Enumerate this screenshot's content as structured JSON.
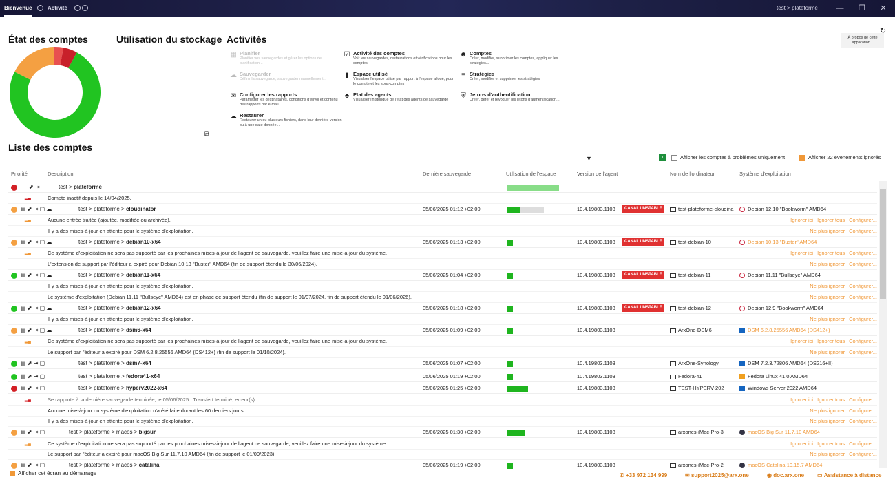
{
  "topbar": {
    "tabs": [
      {
        "label": "Bienvenue"
      },
      {
        "label": "Activité"
      }
    ],
    "path": "test > plateforme"
  },
  "sections": {
    "accounts_state": "État des comptes",
    "storage": "Utilisation du stockage",
    "activities": "Activités",
    "accounts_list": "Liste des comptes"
  },
  "about": {
    "label": "À propos de cette application..."
  },
  "activities": [
    {
      "title": "Planifier",
      "desc": "Planifier vos sauvegardes et gérer les options de planification...",
      "icon": "calendar-icon"
    },
    {
      "title": "Sauvegarder",
      "desc": "Définir la sauvegarde, sauvegarder manuellement...",
      "icon": "cloud-upload-icon"
    },
    {
      "title": "Configurer les rapports",
      "desc": "Paramétrer les destinataires, conditions d'envoi et contenu des rapports par e-mail...",
      "icon": "mail-icon"
    },
    {
      "title": "Restaurer",
      "desc": "Restaurer un ou plusieurs fichiers, dans leur dernière version ou à une date donnée...",
      "icon": "cloud-download-icon"
    },
    {
      "title": "Activité des comptes",
      "desc": "Voir les sauvegardes, restaurations et vérifications pour les comptes",
      "icon": "checklist-icon"
    },
    {
      "title": "Espace utilisé",
      "desc": "Visualiser l'espace utilisé par rapport à l'espace alloué, pour le compte et les sous-comptes",
      "icon": "bar-chart-icon"
    },
    {
      "title": "État des agents",
      "desc": "Visualiser l'historique de l'état des agents de sauvegarde",
      "icon": "agents-icon"
    },
    {
      "title": "Comptes",
      "desc": "Créer, modifier, supprimer les comptes, appliquer les stratégies...",
      "icon": "users-icon"
    },
    {
      "title": "Stratégies",
      "desc": "Créer, modifier et supprimer les stratégies",
      "icon": "strategy-icon"
    },
    {
      "title": "Jetons d'authentification",
      "desc": "Créer, gérer et révoquer les jetons d'authentification...",
      "icon": "shield-icon"
    }
  ],
  "donut": {
    "segments": [
      {
        "label": "ok",
        "fraction": 0.745,
        "color": "#21c421"
      },
      {
        "label": "warning",
        "fraction": 0.17,
        "color": "#f4a042"
      },
      {
        "label": "warning-alt",
        "fraction": 0.035,
        "color": "#e85050"
      },
      {
        "label": "error",
        "fraction": 0.05,
        "color": "#c8202a"
      }
    ]
  },
  "filters": {
    "problems_only": "Afficher les comptes à problèmes uniquement",
    "show_ignored": "Afficher 22 évènements ignorés"
  },
  "columns": [
    "Priorité",
    "Description",
    "Dernière sauvegarde",
    "Utilisation de l'espace",
    "Version de l'agent",
    "Nom de l'ordinateur",
    "Système d'exploitation"
  ],
  "accounts": {
    "root": {
      "name": "plateforme",
      "prefix": "test > ",
      "usage": 1.0,
      "status": "#d32026"
    },
    "root_msg": "Compte inactif depuis le 14/04/2025.",
    "cloudinator": {
      "path": "test > plateforme > ",
      "name": "cloudinator",
      "date": "05/06/2025 01:12 +02:00",
      "usage": 0.38,
      "version": "10.4.19803.1103",
      "badge": "CANAL UNSTABLE",
      "computer": "test-plateforme-cloudina",
      "os": "Debian 12.10 \"Bookworm\" AMD64"
    },
    "cloudinator_msg1": "Aucune entrée traitée (ajoutée, modifiée ou archivée).",
    "cloudinator_msg2": "Il y a des mises-à-jour en attente pour le système d'exploitation.",
    "debian10": {
      "path": "test > plateforme > ",
      "name": "debian10-x64",
      "date": "05/06/2025 01:13 +02:00",
      "usage": 0.12,
      "version": "10.4.19803.1103",
      "badge": "CANAL UNSTABLE",
      "computer": "test-debian-10",
      "os": "Debian 10.13 \"Buster\" AMD64"
    },
    "debian10_msg1": "Ce système d'exploitation ne sera pas supporté par les prochaines mises-à-jour de l'agent de sauvegarde, veuillez faire une mise-à-jour du système.",
    "debian10_msg2": "L'extension de support par l'éditeur a expiré pour Debian 10.13 \"Buster\" AMD64 (fin de support étendu le 30/06/2024).",
    "debian11": {
      "path": "test > plateforme > ",
      "name": "debian11-x64",
      "date": "05/06/2025 01:04 +02:00",
      "usage": 0.12,
      "version": "10.4.19803.1103",
      "badge": "CANAL UNSTABLE",
      "computer": "test-debian-11",
      "os": "Debian 11.11 \"Bullseye\" AMD64"
    },
    "debian11_msg1": "Il y a des mises-à-jour en attente pour le système d'exploitation.",
    "debian11_msg2": "Le système d'exploitation (Debian 11.11 \"Bullseye\" AMD64) est en phase de support étendu (fin de support le 01/07/2024, fin de support étendu le 01/06/2026).",
    "debian12": {
      "path": "test > plateforme > ",
      "name": "debian12-x64",
      "date": "05/06/2025 01:18 +02:00",
      "usage": 0.12,
      "version": "10.4.19803.1103",
      "badge": "CANAL UNSTABLE",
      "computer": "test-debian-12",
      "os": "Debian 12.9 \"Bookworm\" AMD64"
    },
    "debian12_msg1": "Il y a des mises-à-jour en attente pour le système d'exploitation.",
    "dsm6": {
      "path": "test > plateforme > ",
      "name": "dsm6-x64",
      "date": "05/06/2025 01:09 +02:00",
      "usage": 0.12,
      "version": "10.4.19803.1103",
      "computer": "ArxOne-DSM6",
      "os": "DSM 6.2.8.25556 AMD64 (DS412+)"
    },
    "dsm6_msg1": "Ce système d'exploitation ne sera pas supporté par les prochaines mises-à-jour de l'agent de sauvegarde, veuillez faire une mise-à-jour du système.",
    "dsm6_msg2": "Le support par l'éditeur a expiré pour DSM 6.2.8.25556 AMD64 (DS412+) (fin de support le 01/10/2024).",
    "dsm7": {
      "path": "test > plateforme > ",
      "name": "dsm7-x64",
      "date": "05/06/2025 01:07 +02:00",
      "usage": 0.12,
      "version": "10.4.19803.1103",
      "computer": "ArxOne-Synology",
      "os": "DSM 7.2.3.72806 AMD64 (DS216+II)"
    },
    "fedora": {
      "path": "test > plateforme > ",
      "name": "fedora41-x64",
      "date": "05/06/2025 01:19 +02:00",
      "usage": 0.12,
      "version": "10.4.19803.1103",
      "computer": "Fedora-41",
      "os": "Fedora Linux 41.0 AMD64"
    },
    "hyperv": {
      "path": "test > plateforme > ",
      "name": "hyperv2022-x64",
      "date": "05/06/2025 01:25 +02:00",
      "usage": 0.4,
      "version": "10.4.19803.1103",
      "computer": "TEST-HYPERV-202",
      "os": "Windows Server 2022 AMD64"
    },
    "hyperv_msg1": "Se rapporte à la dernière sauvegarde terminée, le 05/06/2025 : Transfert terminé, erreur(s).",
    "hyperv_msg2": "Aucune mise-à-jour du système d'exploitation n'a été faite durant les 60 derniers jours.",
    "hyperv_msg3": "Il y a des mises-à-jour en attente pour le système d'exploitation.",
    "bigsur": {
      "path": "test > plateforme > macos > ",
      "name": "bigsur",
      "date": "05/06/2025 01:30 +02:00",
      "usage": 0.34,
      "version": "10.4.19803.1103",
      "computer": "arxones-iMac-Pro-3",
      "os": "macOS Big Sur 11.7.10 AMD64"
    },
    "bigsur_msg1": "Ce système d'exploitation ne sera pas supporté par les prochaines mises-à-jour de l'agent de sauvegarde, veuillez faire une mise-à-jour du système.",
    "bigsur_msg2": "Le support par l'éditeur a expiré pour macOS Big Sur 11.7.10 AMD64 (fin de support le 01/09/2023).",
    "catalina": {
      "path": "test > plateforme > macos > ",
      "name": "catalina",
      "date": "05/06/2025 01:19 +02:00",
      "usage": 0.12,
      "version": "10.4.19803.1103",
      "computer": "arxones-iMac-Pro-2",
      "os": "macOS Catalina 10.15.7 AMD64"
    }
  },
  "links": {
    "ignore": "Ignorer ici",
    "ignore_all": "Ignorer tous",
    "configure": "Configurer...",
    "no_ignore": "Ne plus ignorer"
  },
  "footer": {
    "show_startup": "Afficher cet écran au démarrage",
    "phone": "+33 972 134 999",
    "email": "support2025@arx.one",
    "doc": "doc.arx.one",
    "remote": "Assistance à distance"
  }
}
